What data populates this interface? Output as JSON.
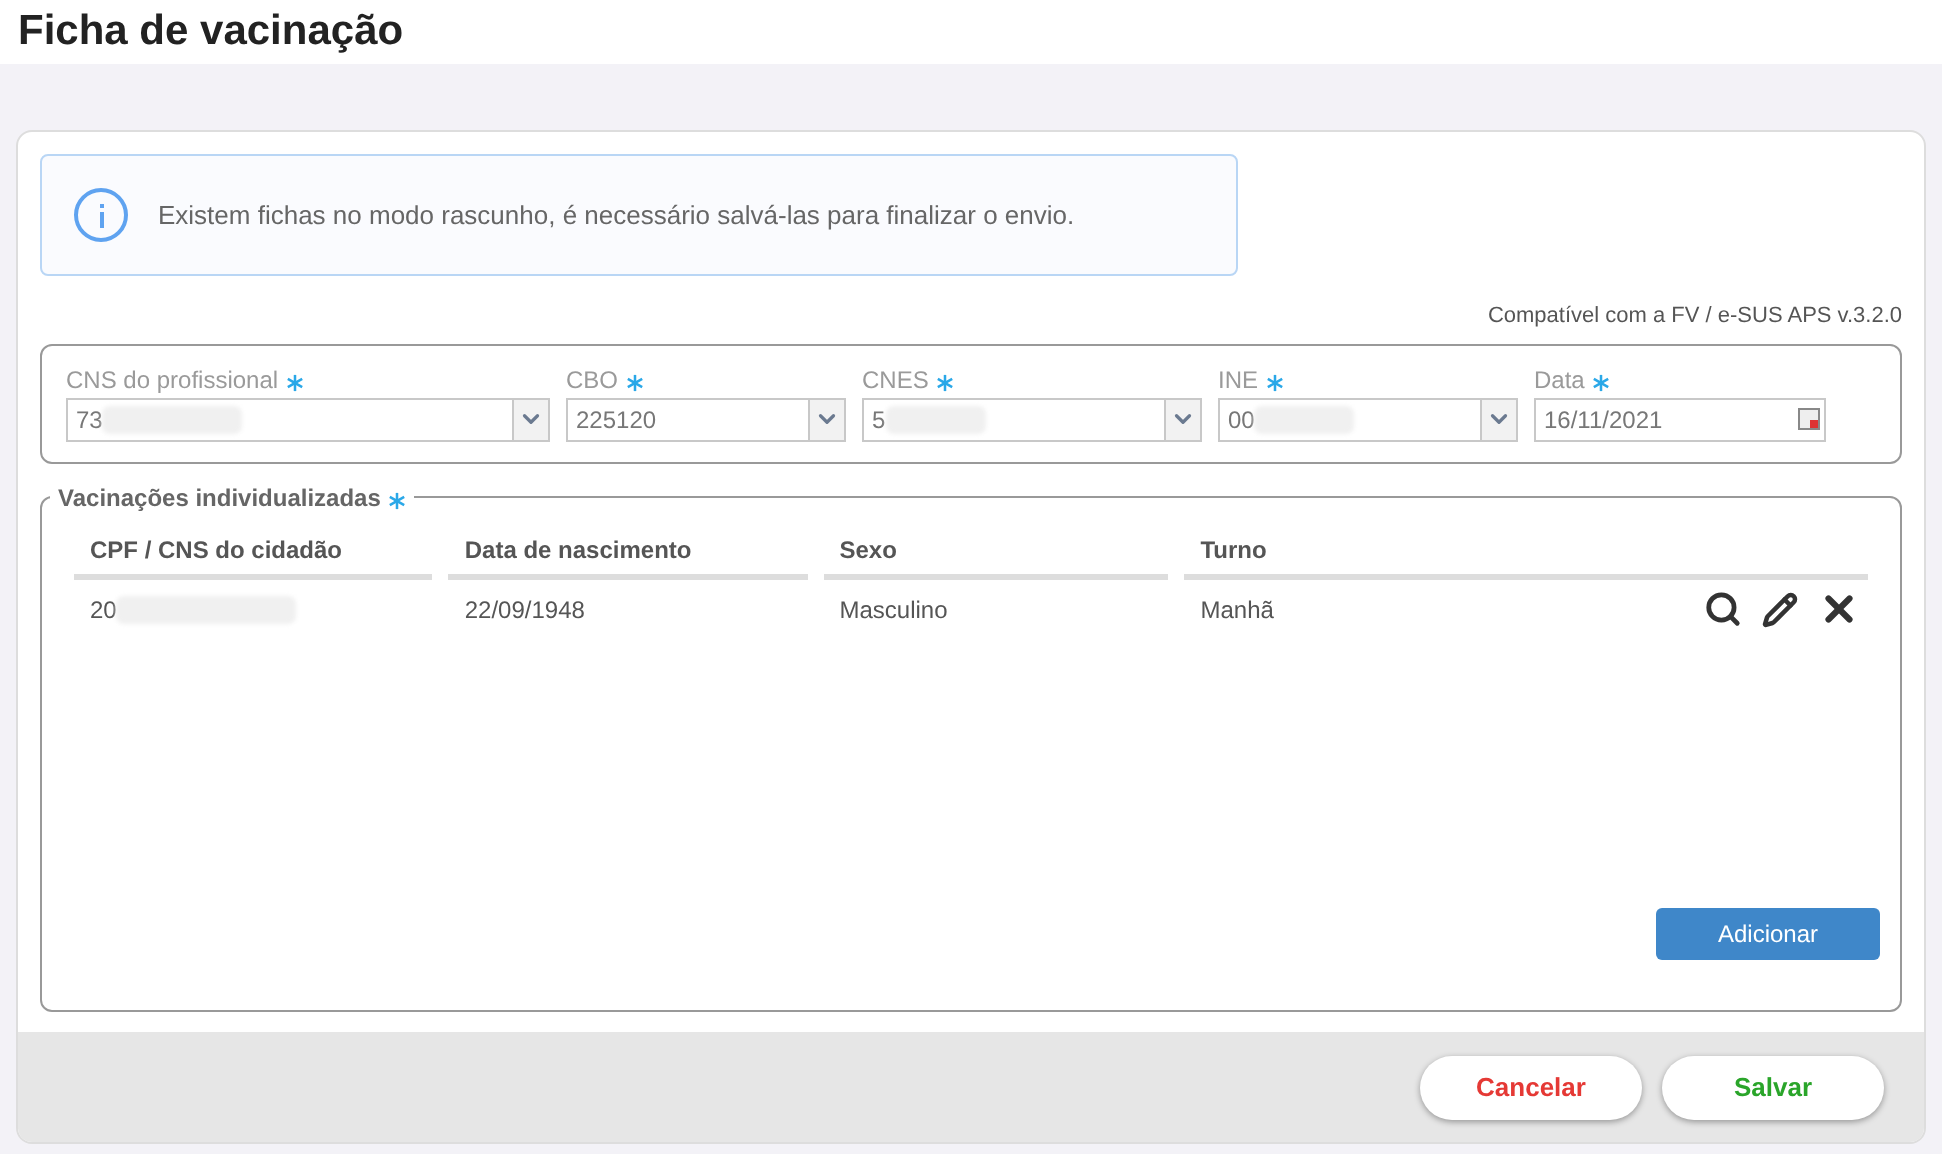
{
  "page_title": "Ficha de vacinação",
  "alert": {
    "text": "Existem fichas no modo rascunho, é necessário salvá-las para finalizar o envio."
  },
  "compat_note": "Compatível com a FV / e-SUS APS v.3.2.0",
  "fields": [
    {
      "label": "CNS do profissional",
      "required": true,
      "value": "73",
      "kind": "select",
      "redacted": true
    },
    {
      "label": "CBO",
      "required": true,
      "value": "225120",
      "kind": "select",
      "redacted": false
    },
    {
      "label": "CNES",
      "required": true,
      "value": "5",
      "kind": "select",
      "redacted": true
    },
    {
      "label": "INE",
      "required": true,
      "value": "00",
      "kind": "select",
      "redacted": true
    },
    {
      "label": "Data",
      "required": true,
      "value": "16/11/2021",
      "kind": "date",
      "redacted": false
    }
  ],
  "section": {
    "title": "Vacinações individualizadas",
    "required": true
  },
  "table": {
    "columns": [
      "CPF / CNS do cidadão",
      "Data de nascimento",
      "Sexo",
      "Turno"
    ],
    "rows": [
      {
        "cells": [
          "20",
          "22/09/1948",
          "Masculino",
          "Manhã"
        ],
        "redacted": true
      }
    ]
  },
  "add_button": "Adicionar",
  "footer_buttons": [
    {
      "label": "Cancelar",
      "kind": "cancel"
    },
    {
      "label": "Salvar",
      "kind": "save"
    }
  ]
}
